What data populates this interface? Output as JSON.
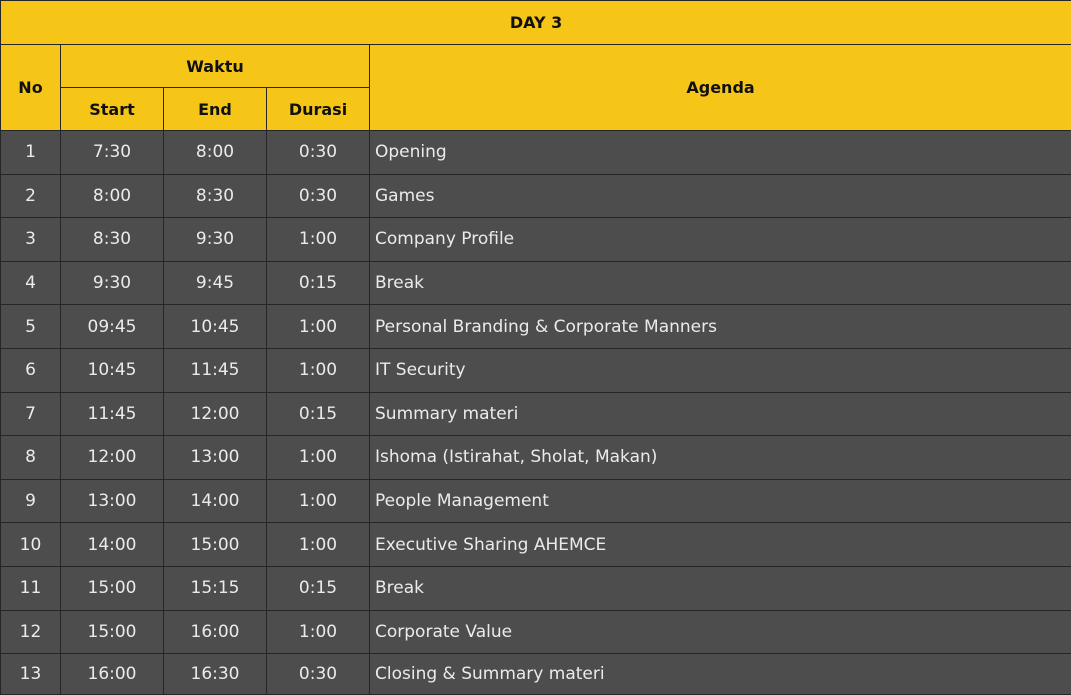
{
  "title": "DAY 3",
  "headers": {
    "no": "No",
    "waktu": "Waktu",
    "start": "Start",
    "end": "End",
    "durasi": "Durasi",
    "agenda": "Agenda"
  },
  "rows": [
    {
      "no": "1",
      "start": "7:30",
      "end": "8:00",
      "durasi": "0:30",
      "agenda": "Opening"
    },
    {
      "no": "2",
      "start": "8:00",
      "end": "8:30",
      "durasi": "0:30",
      "agenda": "Games"
    },
    {
      "no": "3",
      "start": "8:30",
      "end": "9:30",
      "durasi": "1:00",
      "agenda": "Company Profile"
    },
    {
      "no": "4",
      "start": "9:30",
      "end": "9:45",
      "durasi": "0:15",
      "agenda": "Break"
    },
    {
      "no": "5",
      "start": "09:45",
      "end": "10:45",
      "durasi": "1:00",
      "agenda": "Personal Branding & Corporate Manners"
    },
    {
      "no": "6",
      "start": "10:45",
      "end": "11:45",
      "durasi": "1:00",
      "agenda": "IT Security"
    },
    {
      "no": "7",
      "start": "11:45",
      "end": "12:00",
      "durasi": "0:15",
      "agenda": "Summary materi"
    },
    {
      "no": "8",
      "start": "12:00",
      "end": "13:00",
      "durasi": "1:00",
      "agenda": "Ishoma (Istirahat, Sholat, Makan)"
    },
    {
      "no": "9",
      "start": "13:00",
      "end": "14:00",
      "durasi": "1:00",
      "agenda": "People Management"
    },
    {
      "no": "10",
      "start": "14:00",
      "end": "15:00",
      "durasi": "1:00",
      "agenda": "Executive Sharing AHEMCE"
    },
    {
      "no": "11",
      "start": "15:00",
      "end": "15:15",
      "durasi": "0:15",
      "agenda": "Break"
    },
    {
      "no": "12",
      "start": "15:00",
      "end": "16:00",
      "durasi": "1:00",
      "agenda": "Corporate Value"
    },
    {
      "no": "13",
      "start": "16:00",
      "end": "16:30",
      "durasi": "0:30",
      "agenda": "Closing & Summary materi"
    }
  ]
}
